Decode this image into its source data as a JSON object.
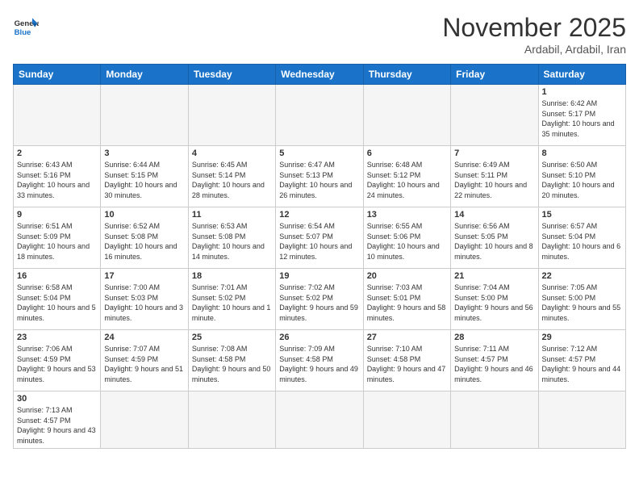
{
  "header": {
    "logo": {
      "general": "General",
      "blue": "Blue"
    },
    "title": "November 2025",
    "subtitle": "Ardabil, Ardabil, Iran"
  },
  "weekdays": [
    "Sunday",
    "Monday",
    "Tuesday",
    "Wednesday",
    "Thursday",
    "Friday",
    "Saturday"
  ],
  "days": {
    "1": {
      "sunrise": "6:42 AM",
      "sunset": "5:17 PM",
      "daylight": "10 hours and 35 minutes."
    },
    "2": {
      "sunrise": "6:43 AM",
      "sunset": "5:16 PM",
      "daylight": "10 hours and 33 minutes."
    },
    "3": {
      "sunrise": "6:44 AM",
      "sunset": "5:15 PM",
      "daylight": "10 hours and 30 minutes."
    },
    "4": {
      "sunrise": "6:45 AM",
      "sunset": "5:14 PM",
      "daylight": "10 hours and 28 minutes."
    },
    "5": {
      "sunrise": "6:47 AM",
      "sunset": "5:13 PM",
      "daylight": "10 hours and 26 minutes."
    },
    "6": {
      "sunrise": "6:48 AM",
      "sunset": "5:12 PM",
      "daylight": "10 hours and 24 minutes."
    },
    "7": {
      "sunrise": "6:49 AM",
      "sunset": "5:11 PM",
      "daylight": "10 hours and 22 minutes."
    },
    "8": {
      "sunrise": "6:50 AM",
      "sunset": "5:10 PM",
      "daylight": "10 hours and 20 minutes."
    },
    "9": {
      "sunrise": "6:51 AM",
      "sunset": "5:09 PM",
      "daylight": "10 hours and 18 minutes."
    },
    "10": {
      "sunrise": "6:52 AM",
      "sunset": "5:08 PM",
      "daylight": "10 hours and 16 minutes."
    },
    "11": {
      "sunrise": "6:53 AM",
      "sunset": "5:08 PM",
      "daylight": "10 hours and 14 minutes."
    },
    "12": {
      "sunrise": "6:54 AM",
      "sunset": "5:07 PM",
      "daylight": "10 hours and 12 minutes."
    },
    "13": {
      "sunrise": "6:55 AM",
      "sunset": "5:06 PM",
      "daylight": "10 hours and 10 minutes."
    },
    "14": {
      "sunrise": "6:56 AM",
      "sunset": "5:05 PM",
      "daylight": "10 hours and 8 minutes."
    },
    "15": {
      "sunrise": "6:57 AM",
      "sunset": "5:04 PM",
      "daylight": "10 hours and 6 minutes."
    },
    "16": {
      "sunrise": "6:58 AM",
      "sunset": "5:04 PM",
      "daylight": "10 hours and 5 minutes."
    },
    "17": {
      "sunrise": "7:00 AM",
      "sunset": "5:03 PM",
      "daylight": "10 hours and 3 minutes."
    },
    "18": {
      "sunrise": "7:01 AM",
      "sunset": "5:02 PM",
      "daylight": "10 hours and 1 minute."
    },
    "19": {
      "sunrise": "7:02 AM",
      "sunset": "5:02 PM",
      "daylight": "9 hours and 59 minutes."
    },
    "20": {
      "sunrise": "7:03 AM",
      "sunset": "5:01 PM",
      "daylight": "9 hours and 58 minutes."
    },
    "21": {
      "sunrise": "7:04 AM",
      "sunset": "5:00 PM",
      "daylight": "9 hours and 56 minutes."
    },
    "22": {
      "sunrise": "7:05 AM",
      "sunset": "5:00 PM",
      "daylight": "9 hours and 55 minutes."
    },
    "23": {
      "sunrise": "7:06 AM",
      "sunset": "4:59 PM",
      "daylight": "9 hours and 53 minutes."
    },
    "24": {
      "sunrise": "7:07 AM",
      "sunset": "4:59 PM",
      "daylight": "9 hours and 51 minutes."
    },
    "25": {
      "sunrise": "7:08 AM",
      "sunset": "4:58 PM",
      "daylight": "9 hours and 50 minutes."
    },
    "26": {
      "sunrise": "7:09 AM",
      "sunset": "4:58 PM",
      "daylight": "9 hours and 49 minutes."
    },
    "27": {
      "sunrise": "7:10 AM",
      "sunset": "4:58 PM",
      "daylight": "9 hours and 47 minutes."
    },
    "28": {
      "sunrise": "7:11 AM",
      "sunset": "4:57 PM",
      "daylight": "9 hours and 46 minutes."
    },
    "29": {
      "sunrise": "7:12 AM",
      "sunset": "4:57 PM",
      "daylight": "9 hours and 44 minutes."
    },
    "30": {
      "sunrise": "7:13 AM",
      "sunset": "4:57 PM",
      "daylight": "9 hours and 43 minutes."
    }
  }
}
